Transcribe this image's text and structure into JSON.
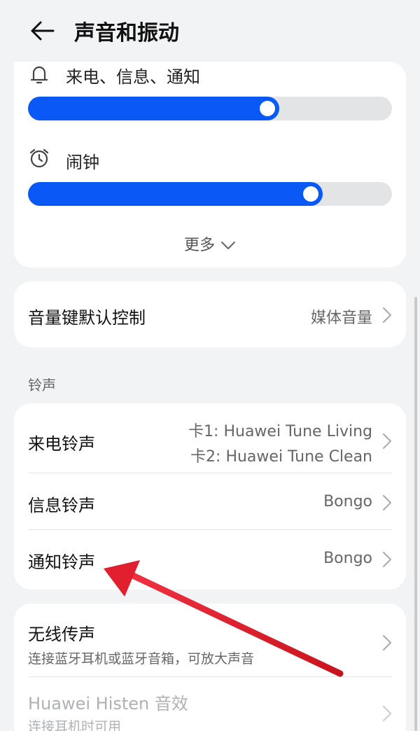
{
  "header": {
    "title": "声音和振动"
  },
  "volume": {
    "ringtone": {
      "label": "来电、信息、通知",
      "level": 0.69,
      "icon": "bell-icon"
    },
    "alarm": {
      "label": "闹钟",
      "level": 0.81,
      "icon": "alarm-clock-icon"
    },
    "more_label": "更多"
  },
  "volume_key": {
    "label": "音量键默认控制",
    "value": "媒体音量"
  },
  "ringtone_section": {
    "title": "铃声",
    "items": [
      {
        "label": "来电铃声",
        "value_line1": "卡1: Huawei Tune Living",
        "value_line2": "卡2: Huawei Tune Clean"
      },
      {
        "label": "信息铃声",
        "value": "Bongo"
      },
      {
        "label": "通知铃声",
        "value": "Bongo"
      }
    ]
  },
  "wireless": {
    "label": "无线传声",
    "sub": "连接蓝牙耳机或蓝牙音箱，可放大声音",
    "histen_label": "Huawei Histen 音效",
    "histen_sub": "连接耳机时可用"
  },
  "colors": {
    "accent": "#0a59f7",
    "annotation_arrow": "#e0202f"
  }
}
